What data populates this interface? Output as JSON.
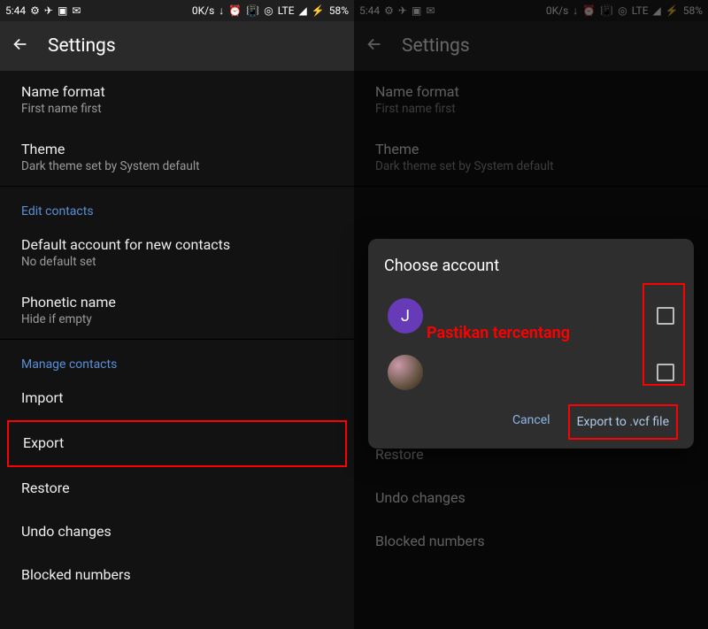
{
  "statusbar": {
    "time": "5:44",
    "speed": "0K/s",
    "lte": "LTE",
    "battery": "58%"
  },
  "appbar": {
    "title": "Settings"
  },
  "items": {
    "nameFormat": {
      "t": "Name format",
      "s": "First name first"
    },
    "theme": {
      "t": "Theme",
      "s": "Dark theme set by System default"
    },
    "editHeader": "Edit contacts",
    "defaultAcct": {
      "t": "Default account for new contacts",
      "s": "No default set"
    },
    "phonetic": {
      "t": "Phonetic name",
      "s": "Hide if empty"
    },
    "manageHeader": "Manage contacts",
    "import": "Import",
    "export": "Export",
    "restore": "Restore",
    "undo": "Undo changes",
    "blocked": "Blocked numbers"
  },
  "dialog": {
    "title": "Choose account",
    "avatar1Initial": "J",
    "cancel": "Cancel",
    "export": "Export to .vcf file",
    "annotation": "Pastikan tercentang"
  }
}
